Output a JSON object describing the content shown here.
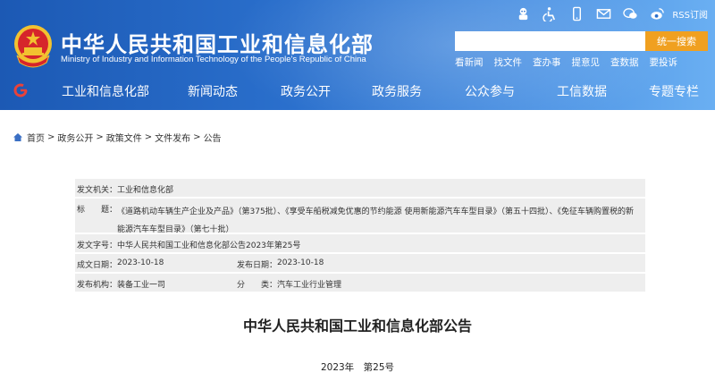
{
  "header": {
    "title": "中华人民共和国工业和信息化部",
    "subtitle": "Ministry of Industry and Information Technology of the People's Republic of China",
    "rss_label": "RSS订阅",
    "search": {
      "placeholder": "",
      "button_label": "统一搜索"
    },
    "quick_links": [
      "看新闻",
      "找文件",
      "查办事",
      "提意见",
      "查数据",
      "要投诉"
    ],
    "icons": [
      "chatbot-icon",
      "accessibility-icon",
      "mobile-icon",
      "mail-icon",
      "wechat-icon",
      "weibo-icon"
    ]
  },
  "nav": {
    "items": [
      "工业和信息化部",
      "新闻动态",
      "政务公开",
      "政务服务",
      "公众参与",
      "工信数据",
      "专题专栏"
    ]
  },
  "breadcrumb": [
    "首页",
    "政务公开",
    "政策文件",
    "文件发布",
    "公告"
  ],
  "info": {
    "issuer_label": "发文机关：",
    "issuer": "工业和信息化部",
    "subject_label": "标　　题：",
    "subject": "《道路机动车辆生产企业及产品》（第375批）、《享受车船税减免优惠的节约能源 使用新能源汽车车型目录》（第五十四批）、《免征车辆购置税的新能源汽车车型目录》（第七十批）",
    "docno_label": "发文字号：",
    "docno": "中华人民共和国工业和信息化部公告2023年第25号",
    "created_label": "成文日期：",
    "created": "2023-10-18",
    "published_label": "发布日期：",
    "published": "2023-10-18",
    "agency_label": "发布机构：",
    "agency": "装备工业一司",
    "category_label": "分　　类：",
    "category": "汽车工业行业管理"
  },
  "document": {
    "title": "中华人民共和国工业和信息化部公告",
    "number": "2023年　第25号"
  },
  "colors": {
    "header_blue": "#1c59b4",
    "search_button": "#f0a020",
    "info_row_bg": "#eeeeee"
  }
}
